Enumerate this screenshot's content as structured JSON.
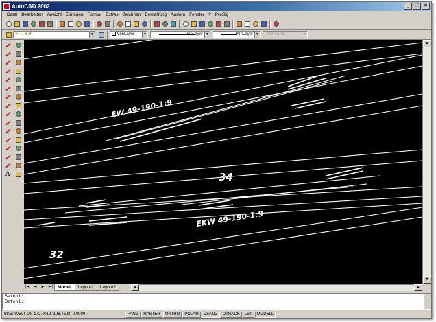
{
  "window": {
    "title": "AutoCAD 2002",
    "controls": {
      "minimize": "_",
      "maximize": "□",
      "close": "×"
    }
  },
  "menu": [
    "Datei",
    "Bearbeiten",
    "Ansicht",
    "Einfügen",
    "Format",
    "Extras",
    "Zeichnen",
    "Bemaßung",
    "Ändern",
    "Fenster",
    "?",
    "ProSig"
  ],
  "toolbar2": {
    "layer": "0",
    "color": "VonLayer",
    "linetype": "VonLayer",
    "lineweight": "VonLayer",
    "plotstyle": "VonFarbe"
  },
  "drawing": {
    "label_ew": "EW 49-190-1:9",
    "label_ekw": "EKW 49-190-1:9",
    "num_34": "34",
    "num_32": "32"
  },
  "tabs": {
    "nav": [
      "|◄",
      "◄",
      "►",
      "►|"
    ],
    "items": [
      "Modell",
      "Layout1",
      "Layout2"
    ],
    "active": "Modell"
  },
  "command": {
    "lines": [
      "Befehl:",
      "Befehl:"
    ]
  },
  "status": {
    "coords": "BKS: WELT OF   172.4012, 196.4623, 0.0000",
    "toggles": [
      "FANG",
      "RASTER",
      "ORTHO",
      "POLAR",
      "OFANG",
      "OTRACK",
      "LST",
      "MODELL"
    ]
  },
  "colors": {
    "title_start": "#0a246a",
    "title_end": "#a6caf0",
    "canvas": "#000000",
    "drawing": "#ffffff"
  },
  "icons": {
    "toolbar1": [
      "new-icon",
      "open-icon",
      "save-icon",
      "print-icon",
      "preview-icon",
      "plot-icon",
      "sep",
      "cut-icon",
      "copy-icon",
      "paste-icon",
      "matchprop-icon",
      "sep",
      "undo-icon",
      "redo-icon",
      "sep",
      "pan-icon",
      "zoom-icon",
      "zoom-window-icon",
      "zoom-prev-icon",
      "sep",
      "properties-icon",
      "designcenter-icon",
      "toolpalette-icon",
      "sep",
      "layer-icon",
      "dist-icon",
      "area-icon",
      "id-icon",
      "region-icon",
      "list-icon",
      "sep",
      "snap-icon",
      "osnap-icon",
      "polar-icon",
      "otrack-icon",
      "sep",
      "help-icon"
    ],
    "left": [
      "line-icon",
      "move-icon",
      "xline-icon",
      "copy-icon",
      "polyline-icon",
      "mirror-icon",
      "polygon-icon",
      "offset-icon",
      "rectangle-icon",
      "array-icon",
      "arc-icon",
      "rotate-icon",
      "circle-icon",
      "scale-icon",
      "spline-icon",
      "stretch-icon",
      "ellipse-icon",
      "trim-icon",
      "insert-icon",
      "extend-icon",
      "block-icon",
      "break-icon",
      "point-icon",
      "chamfer-icon",
      "hatch-icon",
      "fillet-icon",
      "region-icon",
      "explode-icon",
      "table-icon",
      "lengthen-icon",
      "text-icon",
      "erase-icon"
    ]
  }
}
